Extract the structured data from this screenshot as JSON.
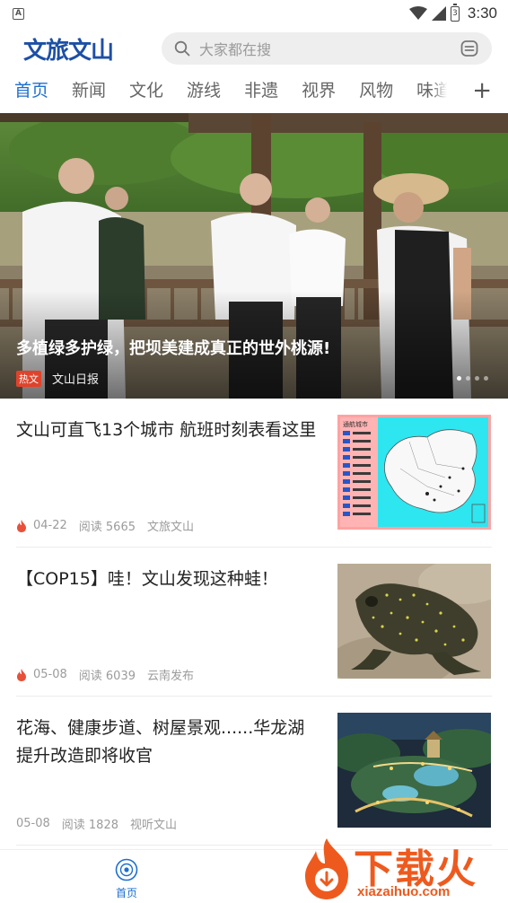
{
  "status_bar": {
    "notification_app_letter": "A",
    "time": "3:30",
    "battery_level": "3"
  },
  "header": {
    "logo": "文旅文山",
    "search_placeholder": "大家都在搜"
  },
  "tabs": [
    {
      "label": "首页",
      "active": true
    },
    {
      "label": "新闻"
    },
    {
      "label": "文化"
    },
    {
      "label": "游线"
    },
    {
      "label": "非遗"
    },
    {
      "label": "视界"
    },
    {
      "label": "风物"
    },
    {
      "label": "味道"
    }
  ],
  "tab_add_symbol": "+",
  "banner": {
    "title": "多植绿多护绿，把坝美建成真正的世外桃源!",
    "badge": "热文",
    "source": "文山日报",
    "dot_count": 4,
    "active_dot": 0
  },
  "news": [
    {
      "title": "文山可直飞13个城市 航班时刻表看这里",
      "date": "04-22",
      "reads": "阅读 5665",
      "source": "文旅文山",
      "hot": true,
      "thumb_label": "通航城市"
    },
    {
      "title": "【COP15】哇！文山发现这种蛙！",
      "date": "05-08",
      "reads": "阅读 6039",
      "source": "云南发布",
      "hot": true
    },
    {
      "title": "花海、健康步道、树屋景观......华龙湖提升改造即将收官",
      "date": "05-08",
      "reads": "阅读 1828",
      "source": "视听文山",
      "hot": false
    }
  ],
  "bottom_nav": {
    "home_label": "首页"
  },
  "watermark": {
    "text": "下载火",
    "url": "xiazaihuo.com"
  },
  "colors": {
    "accent": "#1d6fd0",
    "logo": "#1d4fa6",
    "hot": "#e0432b",
    "watermark": "#ee5a1e"
  }
}
